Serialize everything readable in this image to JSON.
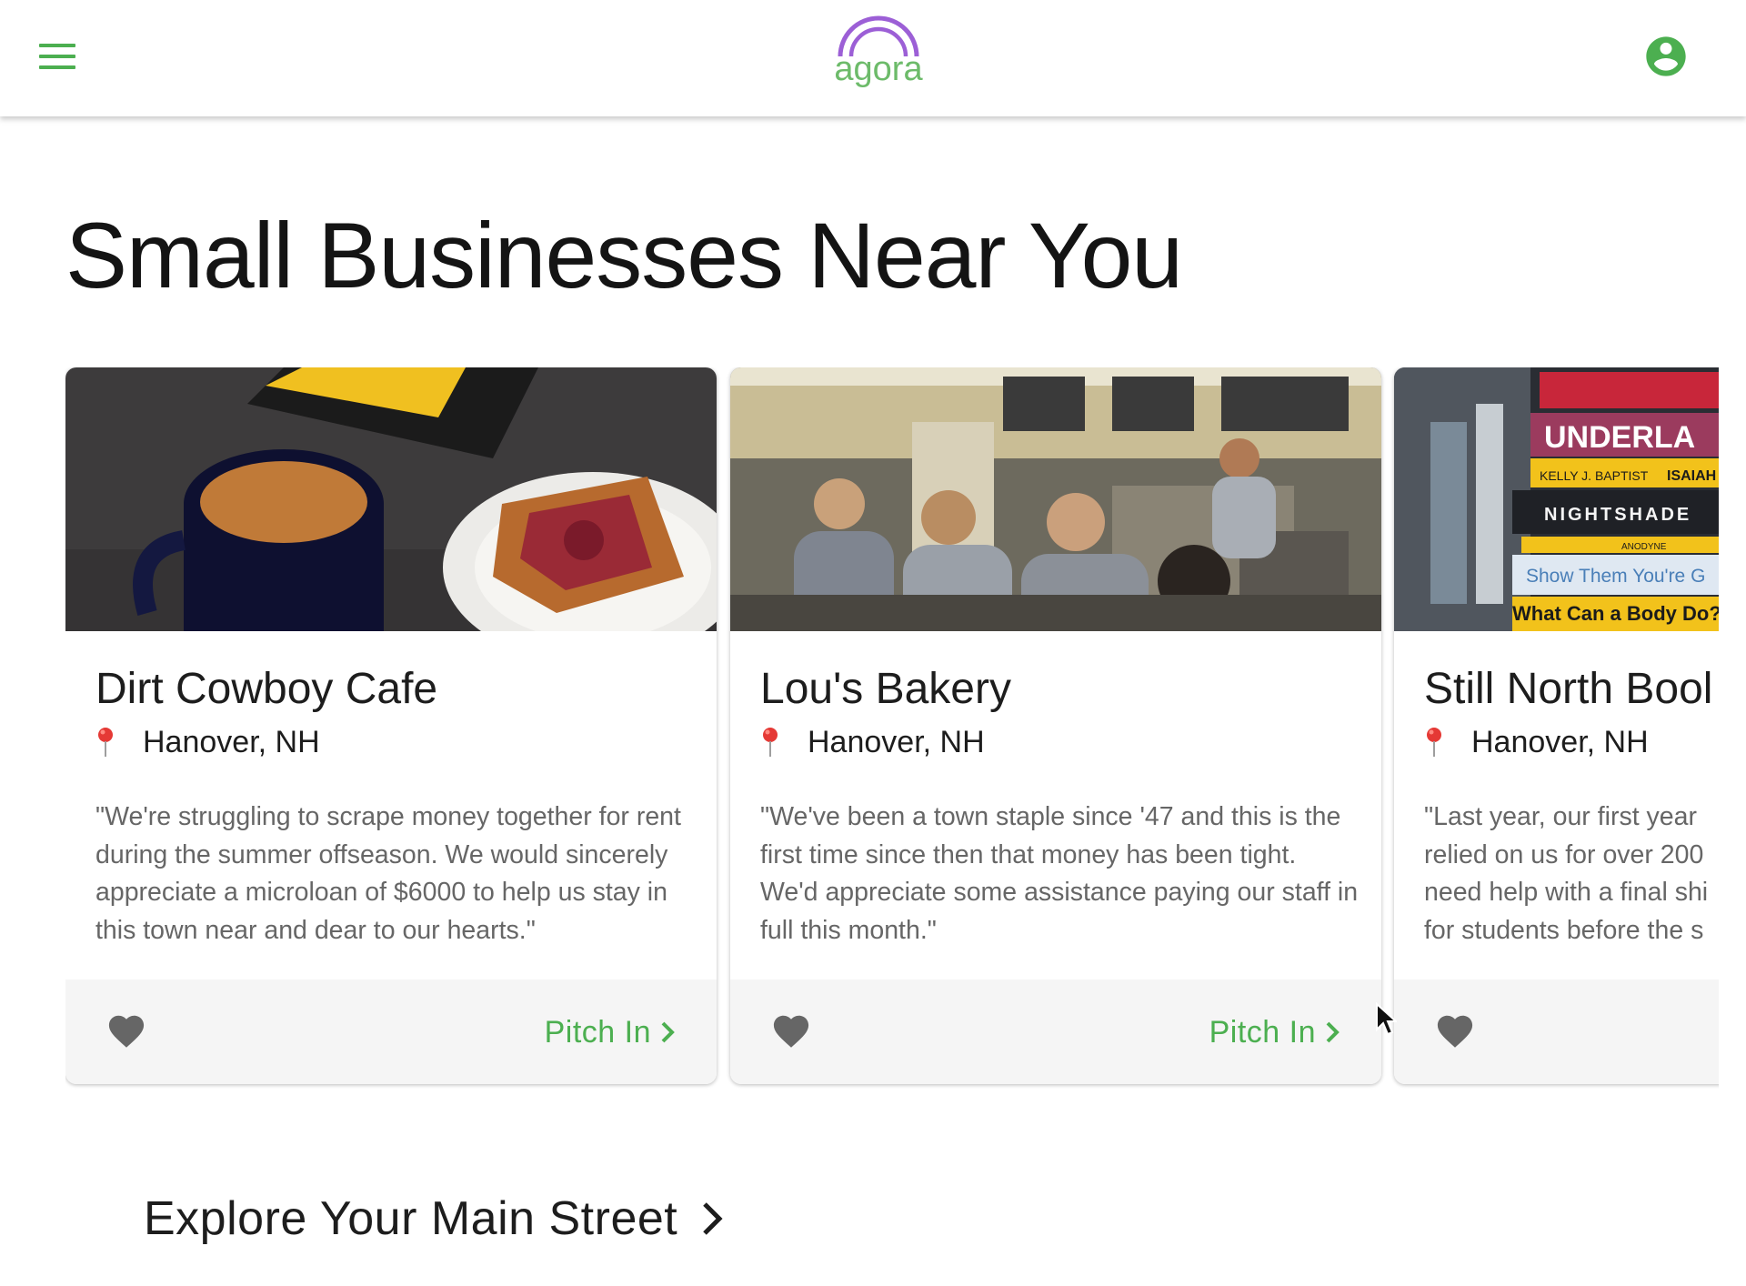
{
  "app": {
    "logo_text": "agora",
    "menu_icon": "hamburger-menu-icon",
    "account_icon": "account-circle-icon"
  },
  "colors": {
    "accent_green": "#4caf50",
    "logo_purple": "#9c5fd6",
    "logo_green": "#6dbb6a",
    "pin_red": "#e53935",
    "heart_gray": "#666666",
    "footer_bg": "#f5f5f5",
    "desc_gray": "#666666"
  },
  "main": {
    "title": "Small Businesses Near You",
    "explore_label": "Explore Your Main Street"
  },
  "businesses": [
    {
      "name": "Dirt Cowboy Cafe",
      "location": "Hanover, NH",
      "description": "\"We're struggling to scrape money together for rent during the summer offseason. We would sincerely appreciate a microloan of $6000 to help us stay in this town near and dear to our hearts.\"",
      "pitch_label": "Pitch In",
      "image_subject": "coffee mug and pastry on a table"
    },
    {
      "name": "Lou's Bakery",
      "location": "Hanover, NH",
      "description": "\"We've been a town staple since '47 and this is the first time since then that money has been tight. We'd appreciate some assistance paying our staff in full this month.\"",
      "pitch_label": "Pitch In",
      "image_subject": "busy diner counter"
    },
    {
      "name": "Still North Bool",
      "location": "Hanover, NH",
      "description": "\"Last year, our first year relied on us for over 200 need help with a final shi for students before the s",
      "pitch_label": "",
      "image_subject": "stack of books",
      "book_spines": [
        "UNDERLA",
        "KELLY J. BAPTIST",
        "ISAIAH",
        "NIGHTSHADE",
        "ANODYNE",
        "Show Them You're G",
        "What Can a Body Do?"
      ]
    }
  ]
}
